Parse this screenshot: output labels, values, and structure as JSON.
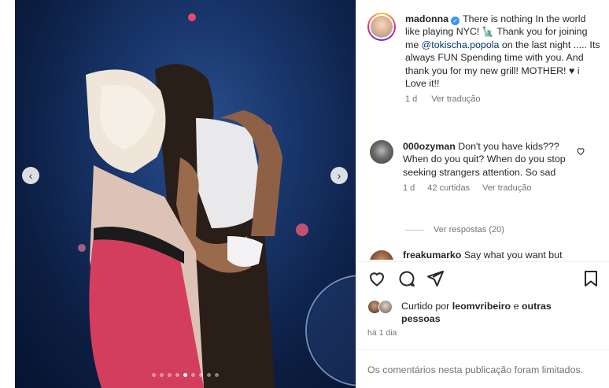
{
  "post": {
    "username": "madonna",
    "caption": "There is nothing In the world like playing NYC! 🗽 Thank you for joining me",
    "mention": "@tokischa.popola",
    "caption_rest": "on the last night ..... Its always FUN Spending time with you. And thank you for my new grill! MOTHER! ♥ i Love it!!",
    "age": "1 d",
    "translate": "Ver tradução"
  },
  "comment": {
    "username": "000ozyman",
    "text": "Don't you have kids??? When do you quit? When do you stop seeking strangers attention. So sad",
    "age": "1 d",
    "likes": "42 curtidas",
    "translate": "Ver tradução",
    "replies": "Ver respostas (20)"
  },
  "comment2": {
    "username": "freakumarko",
    "text": "Say what you want but"
  },
  "likes": {
    "prefix": "Curtido por",
    "user": "leomvribeiro",
    "and": "e",
    "others": "outras pessoas"
  },
  "time_ago": "há 1 dia",
  "comments_limited": "Os comentários nesta publicação foram limitados.",
  "carousel": {
    "prev": "‹",
    "next": "›",
    "dot_count": 9,
    "active_dot": 4
  },
  "icons": {
    "like": "heart-icon",
    "comment": "comment-icon",
    "share": "share-icon",
    "save": "bookmark-icon",
    "comment_like": "heart-icon",
    "verified": "verified-badge-icon"
  },
  "colors": {
    "text": "#262626",
    "secondary": "#737373",
    "link": "#00376b",
    "verified": "#3897f0",
    "stage": "#18356a"
  }
}
